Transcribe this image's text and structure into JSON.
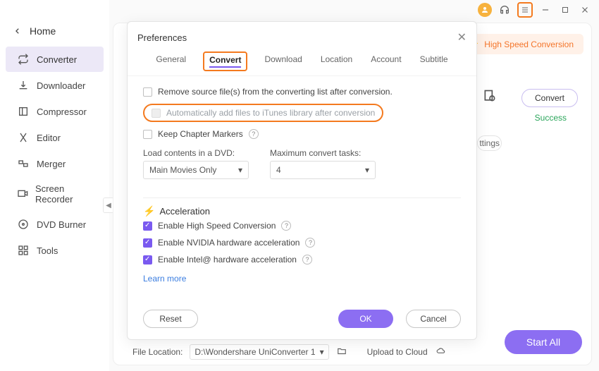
{
  "titlebar": {
    "avatar": "user-avatar",
    "headset": "support-icon",
    "menu": "menu-icon",
    "min": "minimize",
    "max": "maximize",
    "close": "close"
  },
  "sidebar": {
    "home_label": "Home",
    "items": [
      {
        "icon": "converter-icon",
        "label": "Converter",
        "active": true
      },
      {
        "icon": "downloader-icon",
        "label": "Downloader"
      },
      {
        "icon": "compressor-icon",
        "label": "Compressor"
      },
      {
        "icon": "editor-icon",
        "label": "Editor"
      },
      {
        "icon": "merger-icon",
        "label": "Merger"
      },
      {
        "icon": "screen-recorder-icon",
        "label": "Screen Recorder"
      },
      {
        "icon": "dvd-burner-icon",
        "label": "DVD Burner"
      },
      {
        "icon": "tools-icon",
        "label": "Tools"
      }
    ]
  },
  "main": {
    "high_speed_label": "High Speed Conversion",
    "convert_label": "Convert",
    "success_label": "Success",
    "settings_chip": "ttings",
    "start_all_label": "Start All",
    "footer": {
      "file_location_label": "File Location:",
      "file_location_value": "D:\\Wondershare UniConverter 1",
      "upload_label": "Upload to Cloud"
    }
  },
  "dialog": {
    "title": "Preferences",
    "tabs": [
      "General",
      "Convert",
      "Download",
      "Location",
      "Account",
      "Subtitle"
    ],
    "active_tab_index": 1,
    "options": {
      "remove_source": "Remove source file(s) from the converting list after conversion.",
      "auto_itunes": "Automatically add files to iTunes library after conversion",
      "keep_chapters": "Keep Chapter Markers",
      "load_contents_label": "Load contents in a DVD:",
      "load_contents_value": "Main Movies Only",
      "max_tasks_label": "Maximum convert tasks:",
      "max_tasks_value": "4"
    },
    "acceleration": {
      "heading": "Acceleration",
      "enable_hsc": "Enable High Speed Conversion",
      "enable_nvidia": "Enable NVIDIA hardware acceleration",
      "enable_intel": "Enable Intel@ hardware acceleration",
      "learn_more": "Learn more"
    },
    "buttons": {
      "reset": "Reset",
      "ok": "OK",
      "cancel": "Cancel"
    }
  }
}
